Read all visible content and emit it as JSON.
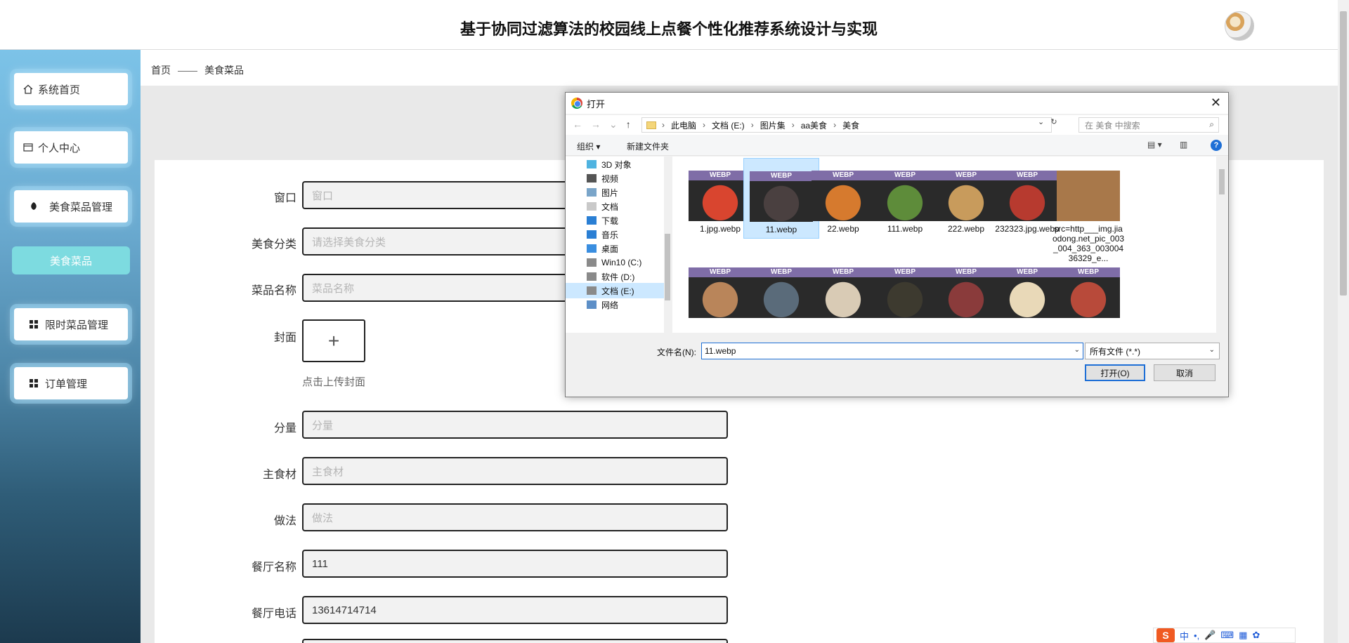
{
  "header": {
    "title": "基于协同过滤算法的校园线上点餐个性化推荐系统设计与实现"
  },
  "sidebar": {
    "items": [
      {
        "label": "系统首页",
        "icon": "home-icon"
      },
      {
        "label": "个人中心",
        "icon": "card-icon"
      },
      {
        "label": "美食菜品管理",
        "icon": "leaf-icon"
      },
      {
        "label": "美食菜品",
        "icon": ""
      },
      {
        "label": "限时菜品管理",
        "icon": "grid-icon"
      },
      {
        "label": "订单管理",
        "icon": "grid-icon"
      }
    ]
  },
  "breadcrumb": {
    "home": "首页",
    "separator": "——",
    "current": "美食菜品"
  },
  "form": {
    "window_label": "窗口",
    "window_placeholder": "窗口",
    "category_label": "美食分类",
    "category_placeholder": "请选择美食分类",
    "dish_name_label": "菜品名称",
    "dish_name_placeholder": "菜品名称",
    "cover_label": "封面",
    "cover_plus": "+",
    "cover_hint": "点击上传封面",
    "portion_label": "分量",
    "portion_placeholder": "分量",
    "ingredient_label": "主食材",
    "ingredient_placeholder": "主食材",
    "method_label": "做法",
    "method_placeholder": "做法",
    "restaurant_label": "餐厅名称",
    "restaurant_value": "111",
    "phone_label": "餐厅电话",
    "phone_value": "13614714714"
  },
  "dialog": {
    "title": "打开",
    "close": "✕",
    "path": [
      "此电脑",
      "文档 (E:)",
      "图片集",
      "aa美食",
      "美食"
    ],
    "search_placeholder": "在 美食 中搜索",
    "toolbar": {
      "organize": "组织 ▾",
      "new_folder": "新建文件夹"
    },
    "nav_items": [
      "3D 对象",
      "视频",
      "图片",
      "文档",
      "下载",
      "音乐",
      "桌面",
      "Win10 (C:)",
      "软件 (D:)",
      "文档 (E:)",
      "网络"
    ],
    "selected_nav": "文档 (E:)",
    "files": [
      {
        "name": "1.jpg.webp",
        "badge": "WEBP",
        "color": "#d9452f"
      },
      {
        "name": "11.webp",
        "badge": "WEBP",
        "color": "#4a4040",
        "selected": true
      },
      {
        "name": "22.webp",
        "badge": "WEBP",
        "color": "#d67a2e"
      },
      {
        "name": "111.webp",
        "badge": "WEBP",
        "color": "#5e8c3a"
      },
      {
        "name": "222.webp",
        "badge": "WEBP",
        "color": "#c89b5c"
      },
      {
        "name": "232323.jpg.webp",
        "badge": "WEBP",
        "color": "#b73a2f"
      },
      {
        "name": "src=http___img.jiaodong.net_pic_003_004_363_00300436329_e...",
        "badge": "",
        "color": "#a8784a"
      }
    ],
    "files_row2": [
      {
        "badge": "WEBP",
        "color": "#b9855a"
      },
      {
        "badge": "WEBP",
        "color": "#5a6b7a"
      },
      {
        "badge": "WEBP",
        "color": "#d9cbb5"
      },
      {
        "badge": "WEBP",
        "color": "#3d3a2f"
      },
      {
        "badge": "WEBP",
        "color": "#8a3b3b"
      },
      {
        "badge": "WEBP",
        "color": "#e9d9b8"
      },
      {
        "badge": "WEBP",
        "color": "#b84a3a"
      }
    ],
    "filename_label": "文件名(N):",
    "filename_value": "11.webp",
    "filetype_value": "所有文件 (*.*)",
    "open_button": "打开(O)",
    "cancel_button": "取消"
  },
  "ime": {
    "logo": "S",
    "lang": "中",
    "dots": "•,",
    "mic": "🎤",
    "kbd": "⌨"
  },
  "colors": {
    "sidebar_active": "#7ddbe0",
    "webp_band": "#7f6da7",
    "accent_blue": "#1e6fd6"
  }
}
